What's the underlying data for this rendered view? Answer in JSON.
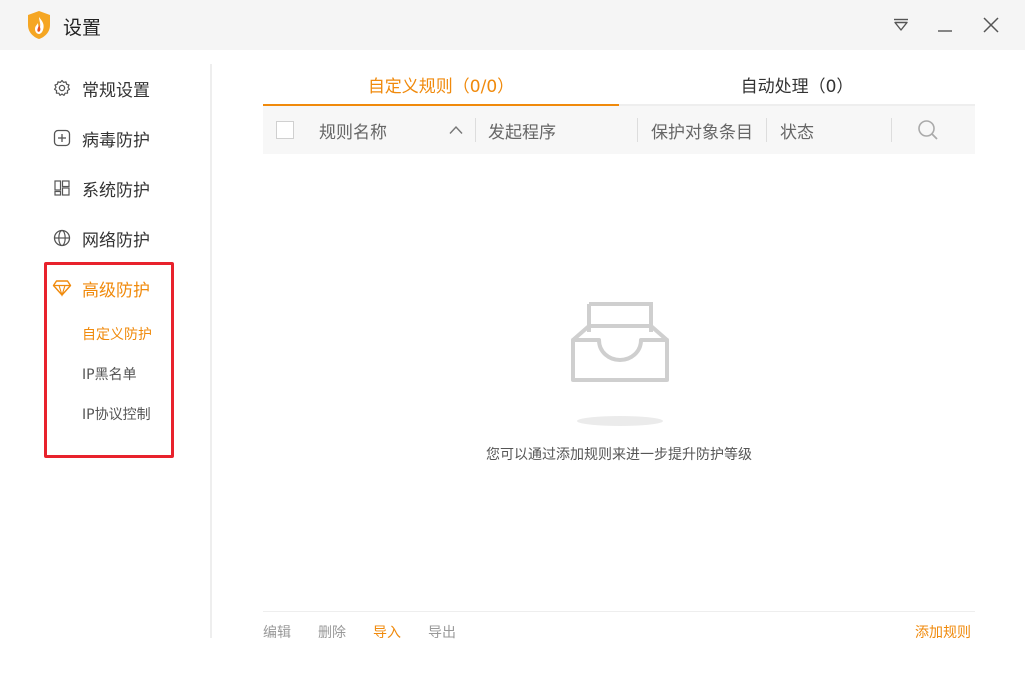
{
  "window": {
    "title": "设置",
    "logo_icon": "flame-shield-icon",
    "controls": [
      "dropdown-icon",
      "minimize-icon",
      "close-icon"
    ]
  },
  "sidebar": {
    "items": [
      {
        "label": "常规设置",
        "icon": "gear-icon"
      },
      {
        "label": "病毒防护",
        "icon": "plus-box-icon"
      },
      {
        "label": "系统防护",
        "icon": "grid-icon"
      },
      {
        "label": "网络防护",
        "icon": "globe-icon"
      },
      {
        "label": "高级防护",
        "icon": "diamond-icon",
        "active": true
      }
    ],
    "sub_items": [
      {
        "label": "自定义防护",
        "active": true
      },
      {
        "label": "IP黑名单"
      },
      {
        "label": "IP协议控制"
      }
    ]
  },
  "tabs": [
    {
      "label": "自定义规则（0/0）",
      "active": true
    },
    {
      "label": "自动处理（0）"
    }
  ],
  "table": {
    "columns": [
      "规则名称",
      "发起程序",
      "保护对象条目",
      "状态"
    ],
    "rows": []
  },
  "empty_state": {
    "icon": "empty-tray-icon",
    "message": "您可以通过添加规则来进一步提升防护等级"
  },
  "footer": {
    "edit": "编辑",
    "delete": "删除",
    "import": "导入",
    "export": "导出",
    "add_rule": "添加规则"
  },
  "colors": {
    "accent": "#f08a0c",
    "highlight_border": "#e8222c",
    "titlebar_bg": "#f5f5f5"
  }
}
